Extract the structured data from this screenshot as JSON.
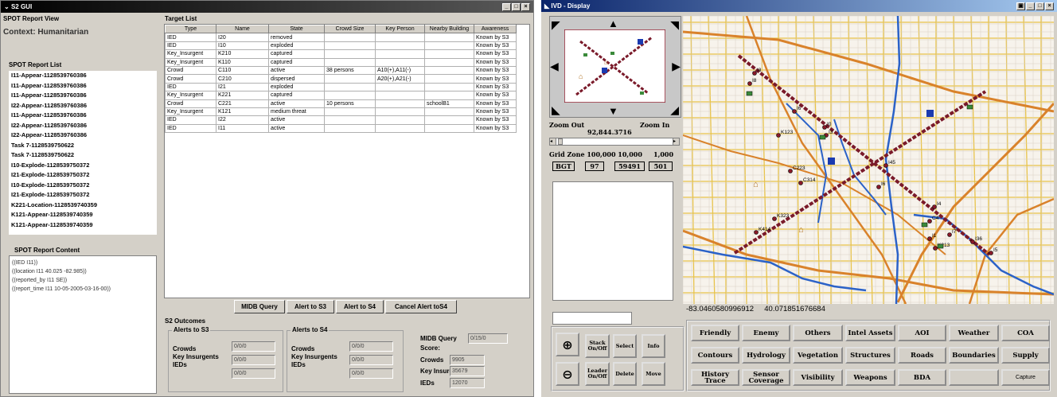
{
  "s2": {
    "title": "S2 GUI",
    "view_label": "SPOT Report View",
    "context": "Context: Humanitarian",
    "list_title": "SPOT Report List",
    "list": [
      "I11-Appear-1128539760386",
      "I11-Appear-1128539760386",
      "I11-Appear-1128539760386",
      "I22-Appear-1128539760386",
      "I11-Appear-1128539760386",
      "I22-Appear-1128539760386",
      "I22-Appear-1128539760386",
      "Task 7-1128539750622",
      "Task 7-1128539750622",
      "I10-Explode-1128539750372",
      "I21-Explode-1128539750372",
      "I10-Explode-1128539750372",
      "I21-Explode-1128539750372",
      "K221-Location-1128539740359",
      "K121-Appear-1128539740359",
      "K121-Appear-1128539740359"
    ],
    "content_title": "SPOT Report Content",
    "content": [
      "((IED I11))",
      "((location I11 40.025 -82.985))",
      "((reported_by I11 SE))",
      "((report_time I11 10-05-2005-03-16-00))"
    ],
    "target_title": "Target List",
    "columns": [
      "Type",
      "Name",
      "State",
      "Crowd Size",
      "Key Person",
      "Nearby Building",
      "Awareness"
    ],
    "rows": [
      [
        "IED",
        "I20",
        "removed",
        "",
        "",
        "",
        "Known by S3"
      ],
      [
        "IED",
        "I10",
        "exploded",
        "",
        "",
        "",
        "Known by S3"
      ],
      [
        "Key_Insurgent",
        "K210",
        "captured",
        "",
        "",
        "",
        "Known by S3"
      ],
      [
        "Key_Insurgent",
        "K110",
        "captured",
        "",
        "",
        "",
        "Known by S3"
      ],
      [
        "Crowd",
        "C110",
        "active",
        "38 persons",
        "A10(+),A11(-)",
        "",
        "Known by S3"
      ],
      [
        "Crowd",
        "C210",
        "dispersed",
        "",
        "A20(+),A21(-)",
        "",
        "Known by S3"
      ],
      [
        "IED",
        "I21",
        "exploded",
        "",
        "",
        "",
        "Known by S3"
      ],
      [
        "Key_Insurgent",
        "K221",
        "captured",
        "",
        "",
        "",
        "Known by S3"
      ],
      [
        "Crowd",
        "C221",
        "active",
        "10 persons",
        "",
        "schoolB1",
        "Known by S3"
      ],
      [
        "Key_Insurgent",
        "K121",
        "medium threat",
        "",
        "",
        "",
        "Known by S3"
      ],
      [
        "IED",
        "I22",
        "active",
        "",
        "",
        "",
        "Known by S3"
      ],
      [
        "IED",
        "I11",
        "active",
        "",
        "",
        "",
        "Known by S3"
      ]
    ],
    "buttons": [
      "MIDB Query",
      "Alert to S3",
      "Alert to S4",
      "Cancel Alert toS4"
    ],
    "outcomes_title": "S2 Outcomes",
    "alerts_s3": "Alerts to S3",
    "alerts_s4": "Alerts to S4",
    "crowds": "Crowds",
    "key_ins": "Key Insurgents",
    "ieds": "IEDs",
    "s3_vals": [
      "0/0/0",
      "0/0/0",
      "0/0/0"
    ],
    "s4_vals": [
      "0/0/0",
      "0/0/0",
      "0/0/0"
    ],
    "midb_query": "MIDB Query",
    "midb_val": "0/15/0",
    "score": "Score:",
    "score_vals": [
      "9905",
      "35679",
      "12070"
    ]
  },
  "ivd": {
    "title": "IVD - Display",
    "zoom_out": "Zoom Out",
    "zoom_in": "Zoom In",
    "zoom_val": "92,844.3716",
    "grid_label": "Grid Zone 100,000 10,000",
    "grid_1000": "1,000",
    "grid_vals": [
      "BGT",
      "97",
      "59491",
      "501"
    ],
    "coords": "-83.0460580996912     40.071851676684",
    "side_buttons": [
      "Stack On/Off",
      "Select",
      "Info",
      "Leader On/Off",
      "Delete",
      "Move"
    ],
    "cat_buttons": [
      [
        "Friendly",
        "Enemy",
        "Others",
        "Intel Assets",
        "AOI",
        "Weather",
        "COA"
      ],
      [
        "Contours",
        "Hydrology",
        "Vegetation",
        "Structures",
        "Roads",
        "Boundaries",
        "Supply"
      ],
      [
        "History Trace",
        "Sensor Coverage",
        "Visibility",
        "Weapons",
        "BDA",
        "",
        "Capture"
      ]
    ],
    "map_labels": [
      "I8",
      "I8",
      "I6",
      "I0",
      "I3",
      "K123",
      "C223",
      "C314",
      "I45",
      "I6",
      "K323",
      "K414",
      "C4",
      "I4",
      "I1",
      "I7",
      "K213",
      "I36",
      "I5"
    ],
    "colors": {
      "road_orange": "#d9822b",
      "road_blue": "#2b62c8",
      "road_yellow": "#e8c34a",
      "track": "#7a1a2a"
    }
  }
}
